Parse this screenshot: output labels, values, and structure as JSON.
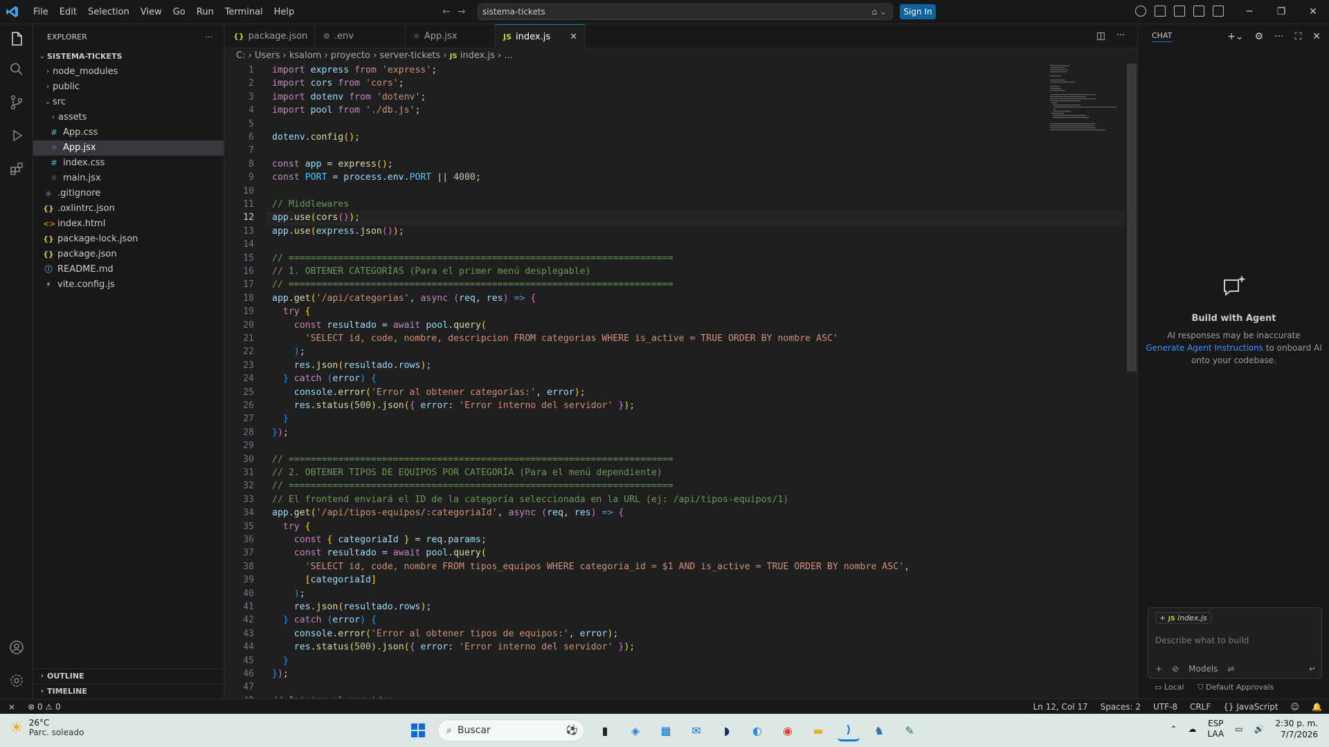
{
  "menu": [
    "File",
    "Edit",
    "Selection",
    "View",
    "Go",
    "Run",
    "Terminal",
    "Help"
  ],
  "command_center": {
    "text": "sistema-tickets"
  },
  "signin_label": "Sign In",
  "sidebar": {
    "title": "EXPLORER",
    "root": "SISTEMA-TICKETS",
    "items": [
      {
        "label": "node_modules",
        "icon": "folder",
        "kind": "folder"
      },
      {
        "label": "public",
        "icon": "folder",
        "kind": "folder"
      },
      {
        "label": "src",
        "icon": "folder-open",
        "kind": "folder"
      },
      {
        "label": "assets",
        "icon": "folder",
        "kind": "folder"
      },
      {
        "label": "App.css",
        "icon": "#",
        "kind": "file"
      },
      {
        "label": "App.jsx",
        "icon": "react",
        "kind": "file"
      },
      {
        "label": "index.css",
        "icon": "#",
        "kind": "file"
      },
      {
        "label": "main.jsx",
        "icon": "react",
        "kind": "file"
      },
      {
        "label": ".gitignore",
        "icon": "git",
        "kind": "file"
      },
      {
        "label": ".oxlintrc.json",
        "icon": "{}",
        "kind": "file"
      },
      {
        "label": "index.html",
        "icon": "<>",
        "kind": "file"
      },
      {
        "label": "package-lock.json",
        "icon": "{}",
        "kind": "file"
      },
      {
        "label": "package.json",
        "icon": "{}",
        "kind": "file"
      },
      {
        "label": "README.md",
        "icon": "info",
        "kind": "file"
      },
      {
        "label": "vite.config.js",
        "icon": "vite",
        "kind": "file"
      }
    ],
    "outline": "OUTLINE",
    "timeline": "TIMELINE"
  },
  "tabs": [
    {
      "label": "package.json",
      "icon": "{}"
    },
    {
      "label": ".env",
      "icon": "gear"
    },
    {
      "label": "App.jsx",
      "icon": "react"
    },
    {
      "label": "index.js",
      "icon": "JS"
    }
  ],
  "breadcrumb": [
    "C:",
    "Users",
    "ksalom",
    "proyecto",
    "server-tickets",
    "index.js",
    "..."
  ],
  "code": {
    "current_line": 12,
    "lines": [
      "import express from 'express';",
      "import cors from 'cors';",
      "import dotenv from 'dotenv';",
      "import pool from './db.js';",
      "",
      "dotenv.config();",
      "",
      "const app = express();",
      "const PORT = process.env.PORT || 4000;",
      "",
      "// Middlewares",
      "app.use(cors());",
      "app.use(express.json());",
      "",
      "// ======================================================================",
      "// 1. OBTENER CATEGORÍAS (Para el primer menú desplegable)",
      "// ======================================================================",
      "app.get('/api/categorias', async (req, res) => {",
      "  try {",
      "    const resultado = await pool.query(",
      "      'SELECT id, code, nombre, descripcion FROM categorias WHERE is_active = TRUE ORDER BY nombre ASC'",
      "    );",
      "    res.json(resultado.rows);",
      "  } catch (error) {",
      "    console.error('Error al obtener categorías:', error);",
      "    res.status(500).json({ error: 'Error interno del servidor' });",
      "  }",
      "});",
      "",
      "// ======================================================================",
      "// 2. OBTENER TIPOS DE EQUIPOS POR CATEGORÍA (Para el menú dependiente)",
      "// ======================================================================",
      "// El frontend enviará el ID de la categoría seleccionada en la URL (ej: /api/tipos-equipos/1)",
      "app.get('/api/tipos-equipos/:categoriaId', async (req, res) => {",
      "  try {",
      "    const { categoriaId } = req.params;",
      "    const resultado = await pool.query(",
      "      'SELECT id, code, nombre FROM tipos_equipos WHERE categoria_id = $1 AND is_active = TRUE ORDER BY nombre ASC',",
      "      [categoriaId]",
      "    );",
      "    res.json(resultado.rows);",
      "  } catch (error) {",
      "    console.error('Error al obtener tipos de equipos:', error);",
      "    res.status(500).json({ error: 'Error interno del servidor' });",
      "  }",
      "});",
      "",
      "// Iniciar el servidor"
    ]
  },
  "chat": {
    "title": "CHAT",
    "heading": "Build with Agent",
    "line1": "AI responses may be inaccurate",
    "link": "Generate Agent Instructions",
    "line2": "to onboard AI",
    "line3": "onto your codebase.",
    "context_file": "index.js",
    "placeholder": "Describe what to build",
    "models": "Models",
    "local": "Local",
    "approvals": "Default Approvals"
  },
  "status": {
    "errors": "0",
    "warnings": "0",
    "position": "Ln 12, Col 17",
    "spaces": "Spaces: 2",
    "encoding": "UTF-8",
    "eol": "CRLF",
    "language": "JavaScript"
  },
  "taskbar": {
    "temp": "26°C",
    "weather": "Parc. soleado",
    "search": "Buscar",
    "lang1": "ESP",
    "lang2": "LAA",
    "time": "2:30 p. m.",
    "date": "7/7/2026"
  }
}
